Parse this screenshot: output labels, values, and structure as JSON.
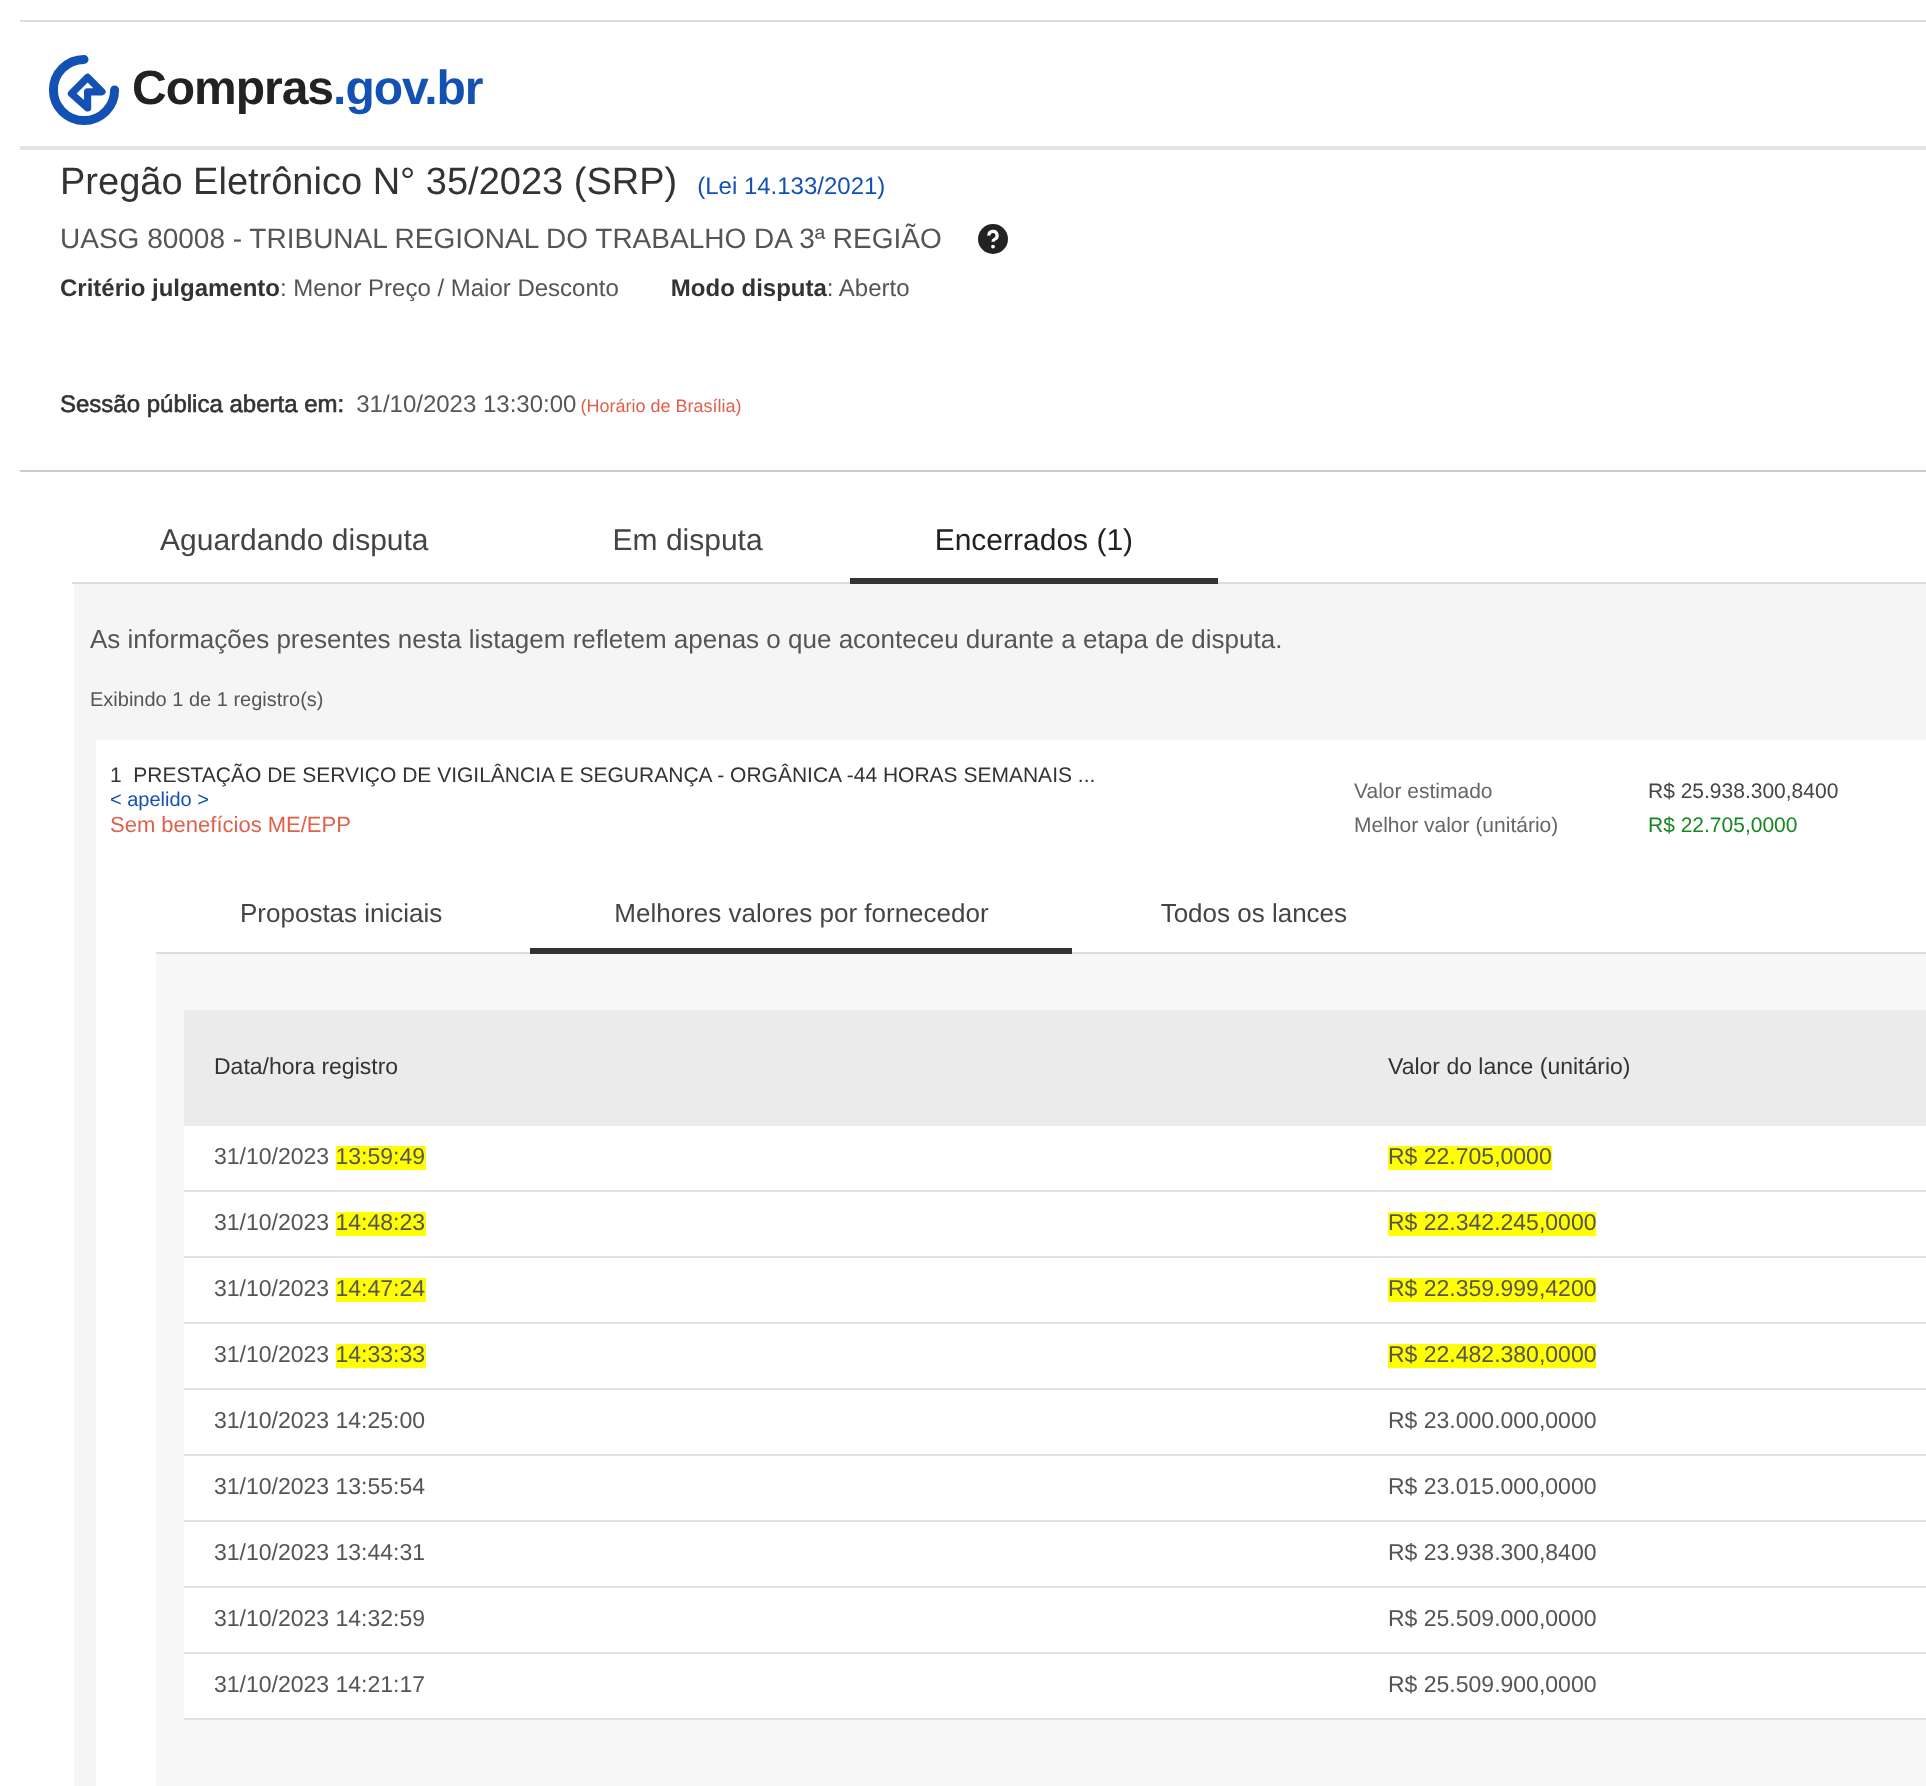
{
  "header": {
    "logo_text": "Compras",
    "logo_suffix": ".gov.br"
  },
  "pregao": {
    "title": "Pregão Eletrônico N° 35/2023 (SRP)",
    "law": "(Lei 14.133/2021)",
    "uasg": "UASG 80008 - TRIBUNAL REGIONAL DO TRABALHO DA 3ª REGIÃO",
    "criteria": [
      "**Critério julgamento**: Menor Preço / Maior Desconto",
      "**Modo disputa**: Aberto"
    ],
    "session_label": "Sessão pública aberta em:",
    "session_value": "31/10/2023 13:30:00",
    "session_note": "(Horário de Brasília)"
  },
  "tabs": [
    {
      "label": "Aguardando disputa",
      "selected": false
    },
    {
      "label": "Em disputa",
      "selected": false
    },
    {
      "label": "Encerrados (1)",
      "selected": true
    }
  ],
  "info": "As informações presentes nesta listagem refletem apenas o que aconteceu durante a etapa de disputa.",
  "count": "Exibindo 1 de 1 registro(s)",
  "item": {
    "number": "1",
    "title": "PRESTAÇÃO DE SERVIÇO DE VIGILÂNCIA E SEGURANÇA - ORGÂNICA -44 HORAS SEMANAIS ...",
    "alias": "< apelido >",
    "benefit": "Sem benefícios ME/EPP",
    "estimated_label": "Valor estimado",
    "estimated_value": "R$ 25.938.300,8400",
    "best_label": "Melhor valor (unitário)",
    "best_value": "R$ 22.705,0000"
  },
  "subtabs": [
    {
      "label": "Propostas iniciais",
      "selected": false
    },
    {
      "label": "Melhores valores por fornecedor",
      "selected": true
    },
    {
      "label": "Todos os lances",
      "selected": false
    }
  ],
  "table": {
    "columns": [
      "Data/hora registro",
      "Valor do lance (unitário)"
    ],
    "rows": [
      {
        "date": "31/10/2023",
        "time": "13:59:49",
        "value": "R$ 22.705,0000",
        "highlighted": true
      },
      {
        "date": "31/10/2023",
        "time": "14:48:23",
        "value": "R$ 22.342.245,0000",
        "highlighted": true
      },
      {
        "date": "31/10/2023",
        "time": "14:47:24",
        "value": "R$ 22.359.999,4200",
        "highlighted": true
      },
      {
        "date": "31/10/2023",
        "time": "14:33:33",
        "value": "R$ 22.482.380,0000",
        "highlighted": true
      },
      {
        "date": "31/10/2023",
        "time": "14:25:00",
        "value": "R$ 23.000.000,0000",
        "highlighted": false
      },
      {
        "date": "31/10/2023",
        "time": "13:55:54",
        "value": "R$ 23.015.000,0000",
        "highlighted": false
      },
      {
        "date": "31/10/2023",
        "time": "13:44:31",
        "value": "R$ 23.938.300,8400",
        "highlighted": false
      },
      {
        "date": "31/10/2023",
        "time": "14:32:59",
        "value": "R$ 25.509.000,0000",
        "highlighted": false
      },
      {
        "date": "31/10/2023",
        "time": "14:21:17",
        "value": "R$ 25.509.900,0000",
        "highlighted": false
      }
    ]
  }
}
